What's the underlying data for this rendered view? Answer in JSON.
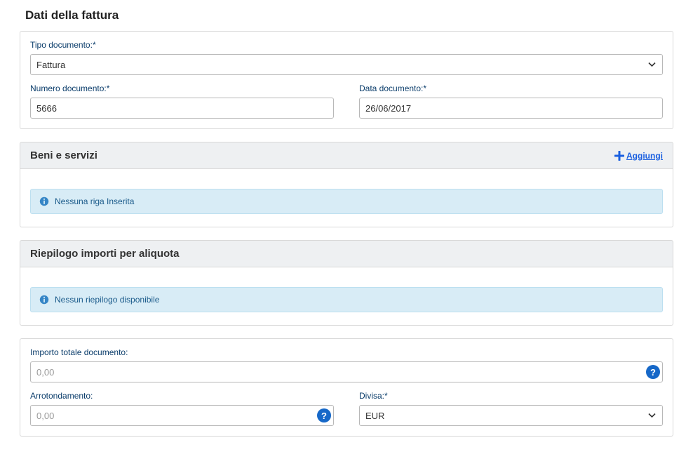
{
  "page": {
    "title": "Dati della fattura"
  },
  "docType": {
    "label": "Tipo documento:*",
    "value": "Fattura"
  },
  "docNumber": {
    "label": "Numero documento:*",
    "value": "5666"
  },
  "docDate": {
    "label": "Data documento:*",
    "value": "26/06/2017"
  },
  "goods": {
    "header": "Beni e servizi",
    "addLabel": "Aggiungi",
    "emptyMsg": "Nessuna riga Inserita"
  },
  "summary": {
    "header": "Riepilogo importi per aliquota",
    "emptyMsg": "Nessun riepilogo disponibile"
  },
  "totals": {
    "totalLabel": "Importo totale documento:",
    "totalPlaceholder": "0,00",
    "roundLabel": "Arrotondamento:",
    "roundPlaceholder": "0,00",
    "currencyLabel": "Divisa:*",
    "currencyValue": "EUR",
    "helpGlyph": "?"
  }
}
